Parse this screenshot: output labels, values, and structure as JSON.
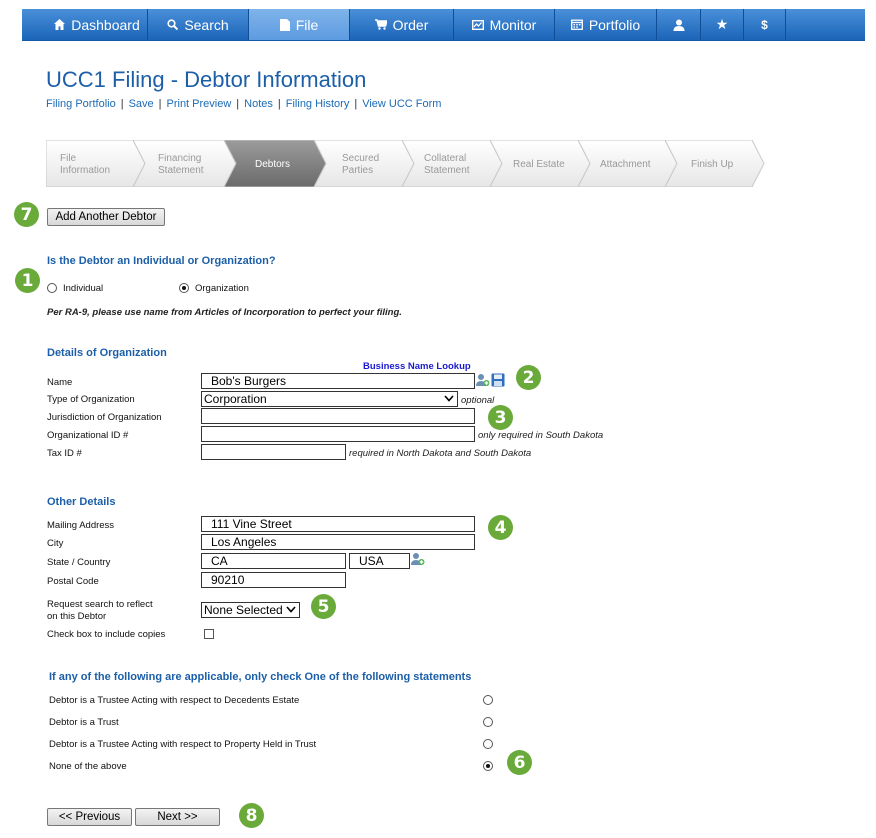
{
  "nav": {
    "items": [
      {
        "label": "Dashboard",
        "icon": "home-icon"
      },
      {
        "label": "Search",
        "icon": "search-icon"
      },
      {
        "label": "File",
        "icon": "file-icon",
        "active": true
      },
      {
        "label": "Order",
        "icon": "cart-icon"
      },
      {
        "label": "Monitor",
        "icon": "monitor-icon"
      },
      {
        "label": "Portfolio",
        "icon": "calendar-icon"
      },
      {
        "label": "",
        "icon": "user-icon"
      },
      {
        "label": "",
        "icon": "star-icon"
      },
      {
        "label": "",
        "icon": "dollar-icon"
      }
    ],
    "icons": {
      "user": "👤",
      "star": "★",
      "dollar": "$"
    }
  },
  "page": {
    "title": "UCC1 Filing - Debtor Information",
    "links": [
      "Filing Portfolio",
      "Save",
      "Print Preview",
      "Notes",
      "Filing History",
      "View UCC Form"
    ]
  },
  "wizard": {
    "steps": [
      {
        "line1": "File",
        "line2": "Information"
      },
      {
        "line1": "Financing",
        "line2": "Statement"
      },
      {
        "line1": "Debtors",
        "line2": "",
        "active": true
      },
      {
        "line1": "Secured",
        "line2": "Parties"
      },
      {
        "line1": "Collateral",
        "line2": "Statement"
      },
      {
        "line1": "Real Estate",
        "line2": ""
      },
      {
        "line1": "Attachment",
        "line2": ""
      },
      {
        "line1": "Finish Up",
        "line2": ""
      }
    ]
  },
  "badges": {
    "b1": "1",
    "b2": "2",
    "b3": "3",
    "b4": "4",
    "b5": "5",
    "b6": "6",
    "b7": "7",
    "b8": "8"
  },
  "buttons": {
    "add_debtor": "Add Another Debtor",
    "previous": "<< Previous",
    "next": "Next >>"
  },
  "debtor_type": {
    "question": "Is the Debtor an Individual or Organization?",
    "individual": "Individual",
    "organization": "Organization",
    "selected": "Organization",
    "note": "Per RA-9, please use name from Articles of Incorporation to perfect your filing."
  },
  "org": {
    "heading": "Details of Organization",
    "lookup_link": "Business Name Lookup",
    "name_label": "Name",
    "name_value": "Bob's Burgers",
    "type_label": "Type of Organization",
    "type_value": "Corporation",
    "type_hint": "optional",
    "jurisdiction_label": "Jurisdiction of Organization",
    "jurisdiction_value": "",
    "org_id_label": "Organizational ID #",
    "org_id_value": "",
    "org_id_hint": "only required in South Dakota",
    "tax_id_label": "Tax ID #",
    "tax_id_value": "",
    "tax_id_hint": "required in North Dakota and South Dakota"
  },
  "other": {
    "heading": "Other Details",
    "address_label": "Mailing Address",
    "address_value": "111 Vine Street",
    "city_label": "City",
    "city_value": "Los Angeles",
    "state_label": "State / Country",
    "state_value": "CA",
    "country_value": "USA",
    "postal_label": "Postal Code",
    "postal_value": "90210",
    "search_label_1": "Request search to reflect",
    "search_label_2": "on this Debtor",
    "search_value": "None Selected",
    "copies_label": "Check box to include copies"
  },
  "statements": {
    "heading": "If any of the following are applicable, only check One of the following statements",
    "items": [
      "Debtor is a Trustee Acting with respect to Decedents Estate",
      "Debtor is a Trust",
      "Debtor is a Trustee Acting with respect to Property Held in Trust",
      "None of the above"
    ],
    "selected_index": 3
  },
  "colors": {
    "nav_blue": "#1b64b8",
    "title_blue": "#1c5fa8",
    "badge_green": "#6aaa3a"
  }
}
